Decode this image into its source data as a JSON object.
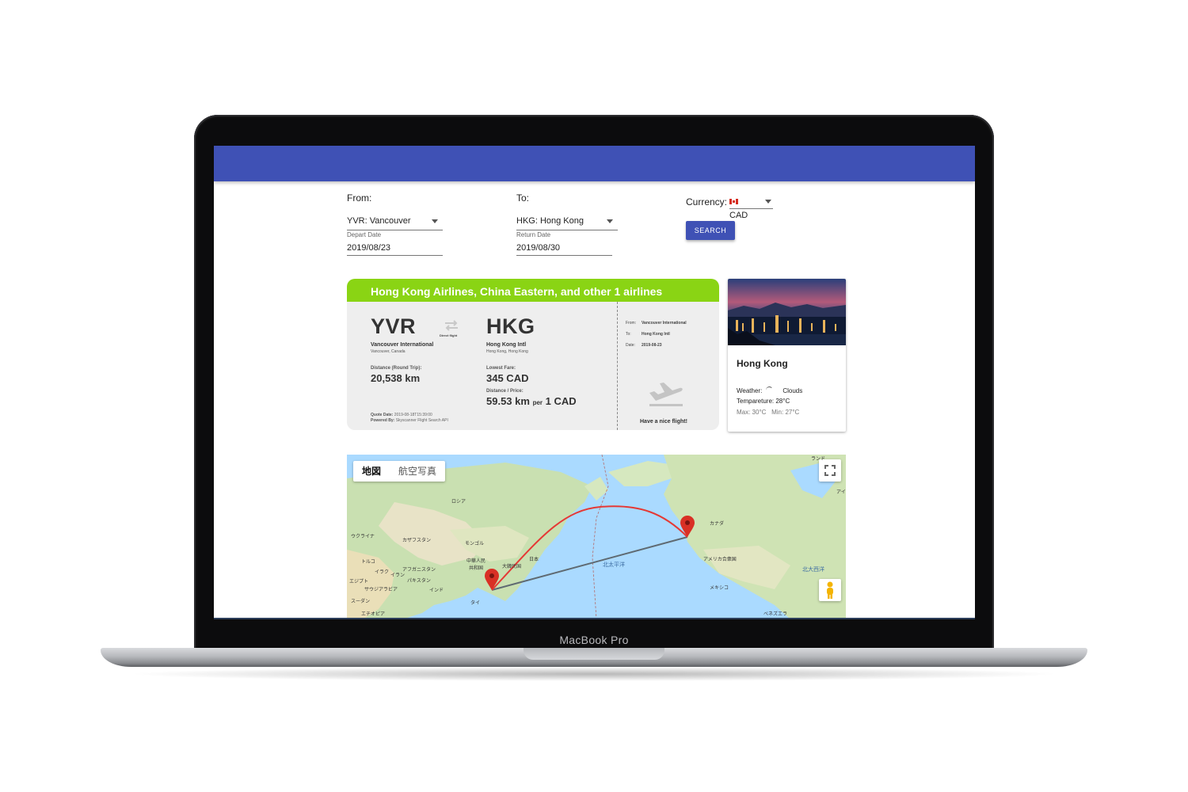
{
  "device": {
    "label": "MacBook Pro"
  },
  "search": {
    "from_label": "From:",
    "from_value": "YVR: Vancouver",
    "to_label": "To:",
    "to_value": "HKG: Hong Kong",
    "depart_label": "Depart Date",
    "depart_value": "2019/08/23",
    "return_label": "Return Date",
    "return_value": "2019/08/30",
    "currency_label": "Currency:",
    "currency_value": "CAD",
    "search_button": "SEARCH"
  },
  "flight": {
    "header": "Hong Kong Airlines, China Eastern, and other 1 airlines",
    "origin_code": "YVR",
    "origin_airport": "Vancouver International",
    "origin_city": "Vancouver, Canada",
    "direct_label": "Direct flight",
    "dest_code": "HKG",
    "dest_airport": "Hong Kong Intl",
    "dest_city": "Hong Kong, Hong Kong",
    "distance_label": "Distance (Round Trip):",
    "distance_value": "20,538 km",
    "fare_label": "Lowest Fare:",
    "fare_value": "345 CAD",
    "ratio_label": "Distance / Price:",
    "ratio_km": "59.53 km",
    "ratio_per": "per",
    "ratio_cad": "1 CAD",
    "quote_label": "Quote Date:",
    "quote_value": "2019-08-18T15:39:00",
    "powered_label": "Powered By:",
    "powered_value": "Skyscanner Flight Search API",
    "stub_from_label": "From:",
    "stub_from_value": "Vancouver International",
    "stub_to_label": "To:",
    "stub_to_value": "Hong Kong Intl",
    "stub_date_label": "Date:",
    "stub_date_value": "2019-08-23",
    "farewell": "Have a nice flight!",
    "accent_color": "#8ad414"
  },
  "city": {
    "name": "Hong Kong",
    "weather_label": "Weather:",
    "weather_value": "Clouds",
    "temperature": "Tempareture: 28°C",
    "max": "Max: 30°C",
    "min": "Min: 27°C"
  },
  "map": {
    "tab_map": "地図",
    "tab_satellite": "航空写真",
    "labels": {
      "russia": "ロシア",
      "kazakhstan": "カザフスタン",
      "mongolia": "モンゴル",
      "china": "中華人民共和国",
      "korea": "大韓民国",
      "japan": "日本",
      "ukraine": "ウクライナ",
      "turkey": "トルコ",
      "iraq": "イラク",
      "iran": "イラン",
      "afghanistan": "アフガニスタン",
      "pakistan": "パキスタン",
      "india": "インド",
      "thailand": "タイ",
      "egypt": "エジプト",
      "saudi": "サウジアラビア",
      "sudan": "スーダン",
      "ethiopia": "エチオピア",
      "north_pacific": "北太平洋",
      "canada": "カナダ",
      "usa": "アメリカ合衆国",
      "mexico": "メキシコ",
      "north_atlantic": "北大西洋",
      "venezuela": "ベネズエラ",
      "greenland": "ランド",
      "iceland": "アイ"
    }
  },
  "colors": {
    "app_bar": "#3f51b5",
    "route_arc": "#e53935",
    "route_line": "#5f6a72",
    "marker": "#d93025"
  }
}
